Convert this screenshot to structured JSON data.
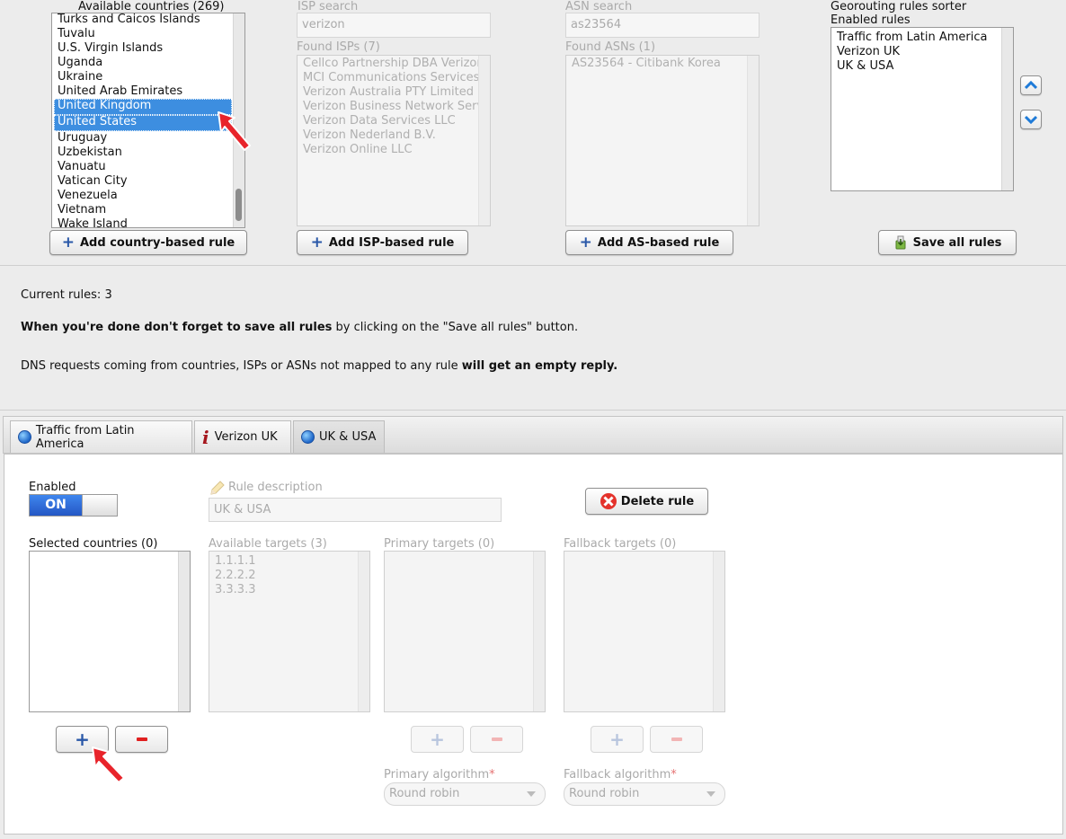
{
  "countries": {
    "header": "Available countries (269)",
    "items": [
      "Turks and Caicos Islands",
      "Tuvalu",
      "U.S. Virgin Islands",
      "Uganda",
      "Ukraine",
      "United Arab Emirates",
      "United Kingdom",
      "United States",
      "Uruguay",
      "Uzbekistan",
      "Vanuatu",
      "Vatican City",
      "Venezuela",
      "Vietnam",
      "Wake Island"
    ],
    "selected": [
      "United Kingdom",
      "United States"
    ],
    "add_button": "Add country-based rule"
  },
  "isp": {
    "search_label": "ISP search",
    "search_value": "verizon",
    "found_label": "Found ISPs (7)",
    "items": [
      "Cellco Partnership DBA Verizon",
      "MCI Communications Services,",
      "Verizon Australia PTY Limited",
      "Verizon Business Network Serv",
      "Verizon Data Services LLC",
      "Verizon Nederland B.V.",
      "Verizon Online LLC"
    ],
    "add_button": "Add ISP-based rule"
  },
  "asn": {
    "search_label": "ASN search",
    "search_value": "as23564",
    "found_label": "Found ASNs (1)",
    "items": [
      "AS23564 - Citibank Korea"
    ],
    "add_button": "Add AS-based rule"
  },
  "sorter": {
    "title": "Georouting rules sorter",
    "enabled_label": "Enabled rules",
    "items": [
      "Traffic from Latin America",
      "Verizon UK",
      "UK & USA"
    ],
    "save_button": "Save all rules"
  },
  "info": {
    "current_rules": "Current rules: 3",
    "reminder_bold": "When you're done don't forget to save all rules",
    "reminder_rest": " by clicking on the \"Save all rules\" button.",
    "dns_text": "DNS requests coming from countries, ISPs or ASNs not mapped to any rule ",
    "dns_bold": "will get an empty reply."
  },
  "tabs": [
    {
      "label": "Traffic from Latin America",
      "icon": "globe-icon"
    },
    {
      "label": "Verizon UK",
      "icon": "info-icon"
    },
    {
      "label": "UK & USA",
      "icon": "globe-icon",
      "active": true
    }
  ],
  "rule": {
    "enabled_label": "Enabled",
    "toggle_text": "ON",
    "description_label": "Rule description",
    "description_value": "UK & USA",
    "delete_button": "Delete rule",
    "selected_countries_label": "Selected countries (0)",
    "available_targets_label": "Available targets (3)",
    "available_targets": [
      "1.1.1.1",
      "2.2.2.2",
      "3.3.3.3"
    ],
    "primary_targets_label": "Primary targets (0)",
    "fallback_targets_label": "Fallback targets (0)",
    "primary_algorithm_label": "Primary algorithm",
    "primary_algorithm_value": "Round robin",
    "fallback_algorithm_label": "Fallback algorithm",
    "fallback_algorithm_value": "Round robin",
    "required_mark": "*",
    "plus": "+",
    "minus": "−"
  },
  "colors": {
    "selection": "#3d8ee0",
    "toggle_on": "#2f6fd8",
    "pointer": "#e8242b",
    "minus": "#e02020",
    "plus": "#2a58a8"
  }
}
